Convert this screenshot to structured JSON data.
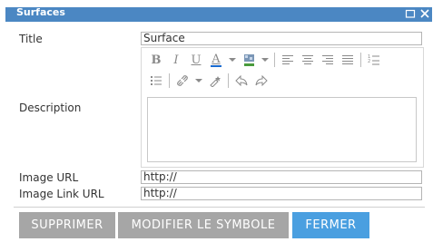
{
  "window": {
    "title": "Surfaces"
  },
  "form": {
    "title_label": "Title",
    "title_value": "Surface",
    "description_label": "Description",
    "image_url_label": "Image URL",
    "image_url_value": "http://",
    "image_link_url_label": "Image Link URL",
    "image_link_url_value": "http://"
  },
  "toolbar": {
    "bold": "B",
    "italic": "I",
    "underline": "U",
    "font_color": "A"
  },
  "buttons": {
    "delete": "SUPPRIMER",
    "modify_symbol": "MODIFIER LE SYMBOLE",
    "close": "FERMER"
  },
  "colors": {
    "titlebar": "#4b87c3",
    "button_gray": "#a6a6a6",
    "button_blue": "#4a9fe0",
    "font_color_underline": "#1a6bd1"
  }
}
